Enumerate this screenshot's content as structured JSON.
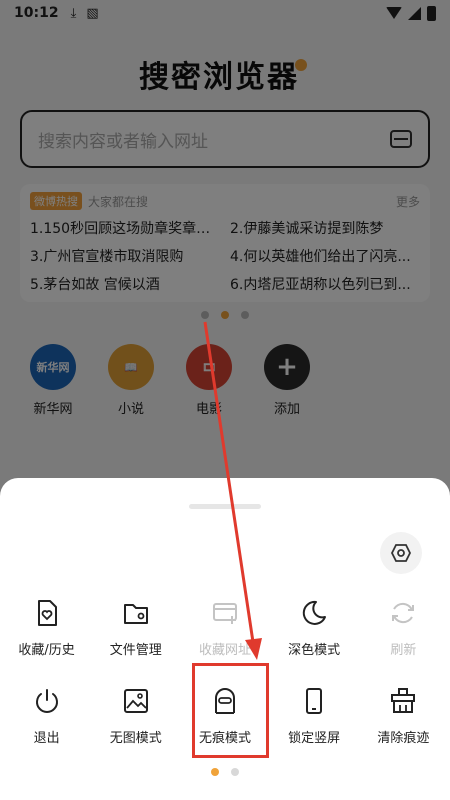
{
  "status_bar": {
    "time": "10:12"
  },
  "header": {
    "title": "搜密浏览器"
  },
  "search": {
    "placeholder": "搜索内容或者输入网址"
  },
  "hot_search": {
    "badge": "微博热搜",
    "subtitle": "大家都在搜",
    "more": "更多",
    "items": [
      "1.150秒回顾这场勋章奖章颁...",
      "2.伊藤美诚采访提到陈梦",
      "3.广州官宣楼市取消限购",
      "4.何以英雄他们给出了闪亮...",
      "5.茅台如故 宫候以酒",
      "6.内塔尼亚胡称以色列已到..."
    ]
  },
  "shortcuts": [
    {
      "label": "新华网",
      "icon_text": "新华网"
    },
    {
      "label": "小说",
      "icon_text": "📖"
    },
    {
      "label": "电影",
      "icon_text": "🎞"
    },
    {
      "label": "添加",
      "icon_text": "+"
    }
  ],
  "menu": {
    "row1": [
      {
        "label": "收藏/历史",
        "icon": "bookmark-history-icon",
        "enabled": true
      },
      {
        "label": "文件管理",
        "icon": "folder-icon",
        "enabled": true
      },
      {
        "label": "收藏网址",
        "icon": "add-bookmark-icon",
        "enabled": false
      },
      {
        "label": "深色模式",
        "icon": "moon-icon",
        "enabled": true
      },
      {
        "label": "刷新",
        "icon": "refresh-icon",
        "enabled": false
      }
    ],
    "row2": [
      {
        "label": "退出",
        "icon": "power-icon",
        "enabled": true
      },
      {
        "label": "无图模式",
        "icon": "no-image-icon",
        "enabled": true
      },
      {
        "label": "无痕模式",
        "icon": "incognito-icon",
        "enabled": true
      },
      {
        "label": "锁定竖屏",
        "icon": "lock-portrait-icon",
        "enabled": true
      },
      {
        "label": "清除痕迹",
        "icon": "clear-traces-icon",
        "enabled": true
      }
    ]
  },
  "colors": {
    "accent": "#f0a33a",
    "annotation": "#e03a2d"
  }
}
